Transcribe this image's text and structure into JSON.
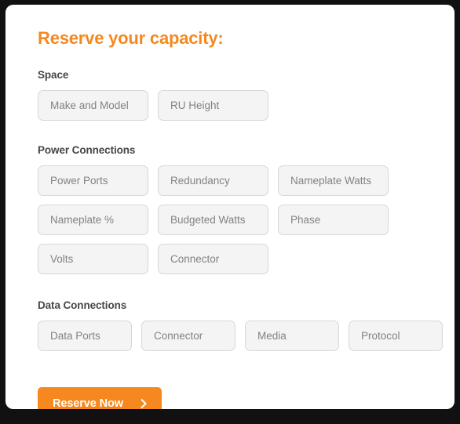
{
  "page": {
    "title": "Reserve your capacity:",
    "accent_color": "#F5881F",
    "heading_color": "#464646",
    "field_bg_color": "#f4f4f4",
    "field_border_color": "#d7d7d7",
    "placeholder_color": "#828282",
    "card_bg_color": "#ffffff",
    "frame_color": "#111111"
  },
  "sections": {
    "space": {
      "heading": "Space",
      "rows": [
        [
          {
            "name": "make-and-model-input",
            "placeholder": "Make and Model",
            "value": ""
          },
          {
            "name": "ru-height-input",
            "placeholder": "RU Height",
            "value": ""
          }
        ]
      ]
    },
    "power": {
      "heading": "Power Connections",
      "rows": [
        [
          {
            "name": "power-ports-input",
            "placeholder": "Power Ports",
            "value": ""
          },
          {
            "name": "redundancy-input",
            "placeholder": "Redundancy",
            "value": ""
          },
          {
            "name": "nameplate-watts-input",
            "placeholder": "Nameplate Watts",
            "value": ""
          }
        ],
        [
          {
            "name": "nameplate-percent-input",
            "placeholder": "Nameplate %",
            "value": ""
          },
          {
            "name": "budgeted-watts-input",
            "placeholder": "Budgeted Watts",
            "value": ""
          },
          {
            "name": "phase-input",
            "placeholder": "Phase",
            "value": ""
          }
        ],
        [
          {
            "name": "volts-input",
            "placeholder": "Volts",
            "value": ""
          },
          {
            "name": "power-connector-input",
            "placeholder": "Connector",
            "value": ""
          }
        ]
      ]
    },
    "data": {
      "heading": "Data Connections",
      "rows": [
        [
          {
            "name": "data-ports-input",
            "placeholder": "Data Ports",
            "value": ""
          },
          {
            "name": "data-connector-input",
            "placeholder": "Connector",
            "value": ""
          },
          {
            "name": "media-input",
            "placeholder": "Media",
            "value": ""
          },
          {
            "name": "protocol-input",
            "placeholder": "Protocol",
            "value": ""
          }
        ]
      ]
    }
  },
  "submit": {
    "label": "Reserve Now",
    "icon": "chevron-right-icon"
  }
}
